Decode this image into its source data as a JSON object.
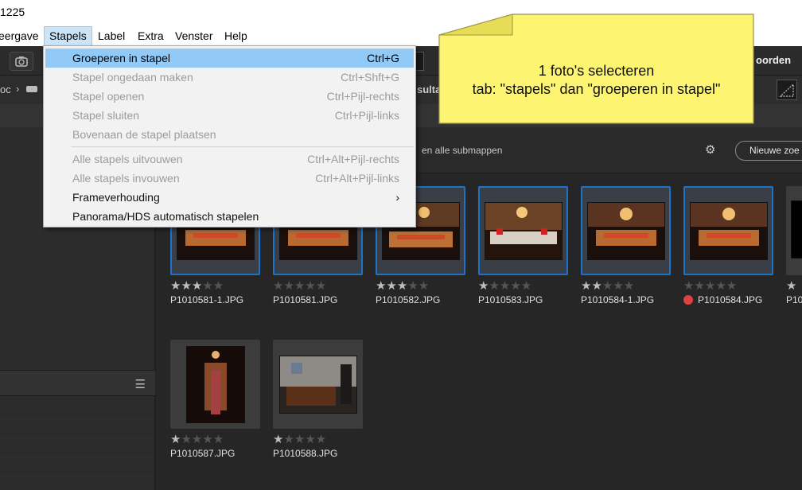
{
  "window": {
    "title": "1225"
  },
  "menubar": [
    {
      "label": "eergave"
    },
    {
      "label": "Stapels"
    },
    {
      "label": "Label"
    },
    {
      "label": "Extra"
    },
    {
      "label": "Venster"
    },
    {
      "label": "Help"
    }
  ],
  "toolbar": {
    "right_label": "oorden"
  },
  "pathbar": {
    "left_fragment": "oc",
    "crumb_fragment": "sulta"
  },
  "filter": {
    "subfolders_text": "en alle submappen",
    "new_button": "Nieuwe zoe"
  },
  "stacks_menu": {
    "items": [
      {
        "label": "Groeperen in stapel",
        "shortcut": "Ctrl+G",
        "enabled": true,
        "highlighted": true
      },
      {
        "label": "Stapel ongedaan maken",
        "shortcut": "Ctrl+Shft+G",
        "enabled": false
      },
      {
        "label": "Stapel openen",
        "shortcut": "Ctrl+Pijl-rechts",
        "enabled": false
      },
      {
        "label": "Stapel sluiten",
        "shortcut": "Ctrl+Pijl-links",
        "enabled": false
      },
      {
        "label": "Bovenaan de stapel plaatsen",
        "shortcut": "",
        "enabled": false
      },
      {
        "label": "Alle stapels uitvouwen",
        "shortcut": "Ctrl+Alt+Pijl-rechts",
        "enabled": false
      },
      {
        "label": "Alle stapels invouwen",
        "shortcut": "Ctrl+Alt+Pijl-links",
        "enabled": false
      },
      {
        "label": "Frameverhouding",
        "shortcut": "›",
        "enabled": true,
        "submenu": true
      },
      {
        "label": "Panorama/HDS automatisch stapelen",
        "shortcut": "",
        "enabled": true
      }
    ]
  },
  "annotation": {
    "line1": "1 foto's selecteren",
    "line2": "tab: \"stapels\" dan \"groeperen in stapel\"",
    "color": "#fdf472"
  },
  "thumbnails": [
    {
      "filename": "P1010581-1.JPG",
      "rating": 3,
      "selected": true
    },
    {
      "filename": "P1010581.JPG",
      "rating": 0,
      "selected": true
    },
    {
      "filename": "P1010582.JPG",
      "rating": 3,
      "selected": true
    },
    {
      "filename": "P1010583.JPG",
      "rating": 1,
      "selected": true
    },
    {
      "filename": "P1010584-1.JPG",
      "rating": 2,
      "selected": true
    },
    {
      "filename": "P1010584.JPG",
      "rating": 0,
      "selected": true,
      "label_color": "red"
    },
    {
      "filename": "P10",
      "rating": 1,
      "selected": false
    },
    {
      "filename": "P1010587.JPG",
      "rating": 1,
      "selected": false
    },
    {
      "filename": "P1010588.JPG",
      "rating": 1,
      "selected": false
    }
  ],
  "colors": {
    "selection_border": "#1e72c8",
    "menu_highlight": "#91c9f7",
    "red_label": "#e04040"
  }
}
